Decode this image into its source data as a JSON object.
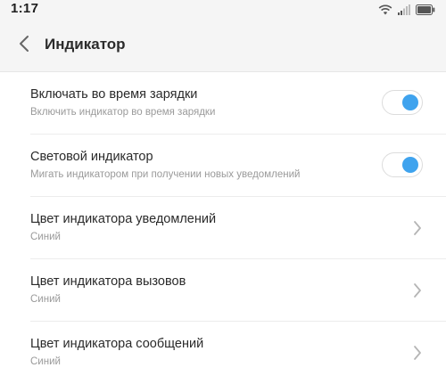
{
  "status_bar": {
    "time": "1:17",
    "icons": [
      "wifi-icon",
      "signal-icon",
      "battery-icon"
    ]
  },
  "header": {
    "back_icon": "chevron-left-icon",
    "title": "Индикатор"
  },
  "colors": {
    "accent": "#3fa3ee",
    "title_text": "#2a2a2a",
    "subtitle_text": "#9a9a9a",
    "header_bg": "#f5f5f5"
  },
  "settings": {
    "items": [
      {
        "title": "Включать во время зарядки",
        "subtitle": "Включить индикатор во время зарядки",
        "control": "toggle",
        "enabled": true
      },
      {
        "title": "Световой индикатор",
        "subtitle": "Мигать индикатором при получении новых уведомлений",
        "control": "toggle",
        "enabled": true
      },
      {
        "title": "Цвет индикатора уведомлений",
        "subtitle": "Синий",
        "control": "chevron"
      },
      {
        "title": "Цвет индикатора вызовов",
        "subtitle": "Синий",
        "control": "chevron"
      },
      {
        "title": "Цвет индикатора сообщений",
        "subtitle": "Синий",
        "control": "chevron"
      }
    ]
  }
}
